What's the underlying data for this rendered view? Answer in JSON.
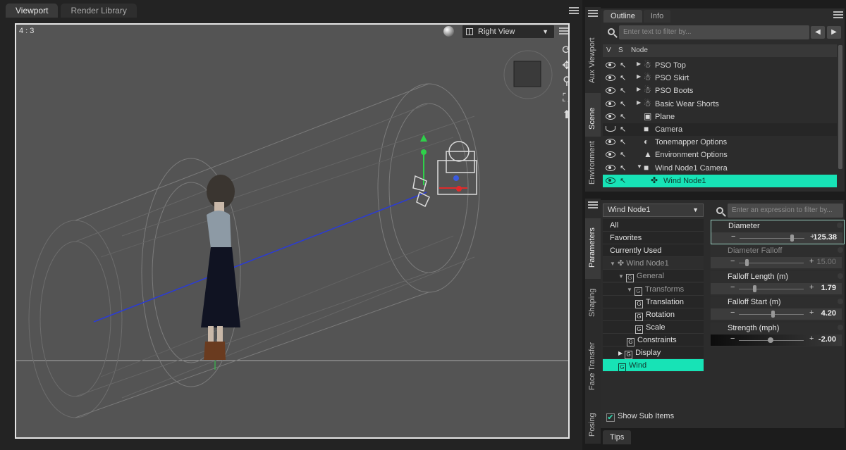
{
  "doc_tabs": [
    {
      "label": "Viewport",
      "active": true
    },
    {
      "label": "Render Library",
      "active": false
    }
  ],
  "viewport": {
    "aspect": "4 : 3",
    "view_name": "Right View"
  },
  "side_tabs": {
    "top": [
      "Aux Viewport",
      "Scene",
      "Environment"
    ],
    "bottom": [
      "Parameters",
      "Shaping",
      "Face Transfer",
      "Posing"
    ]
  },
  "scene": {
    "tabs": [
      "Outline",
      "Info"
    ],
    "filter_placeholder": "Enter text to filter by...",
    "columns": {
      "v": "V",
      "s": "S",
      "node": "Node"
    },
    "nodes": [
      {
        "label": "PSO Top",
        "icon": "figure-icon",
        "expander": "▶",
        "state": "normal"
      },
      {
        "label": "PSO Skirt",
        "icon": "figure-icon",
        "expander": "▶",
        "state": "normal"
      },
      {
        "label": "PSO Boots",
        "icon": "figure-icon",
        "expander": "▶",
        "state": "normal"
      },
      {
        "label": "Basic Wear Shorts",
        "icon": "figure-icon",
        "expander": "▶",
        "state": "normal"
      },
      {
        "label": "Plane",
        "icon": "cube-icon",
        "expander": "",
        "state": "normal"
      },
      {
        "label": "Camera",
        "icon": "camera-icon",
        "expander": "",
        "state": "hidden"
      },
      {
        "label": "Tonemapper Options",
        "icon": "tonemapper-icon",
        "expander": "",
        "state": "normal"
      },
      {
        "label": "Environment Options",
        "icon": "environment-icon",
        "expander": "",
        "state": "normal"
      },
      {
        "label": "Wind Node1 Camera",
        "icon": "camera-icon",
        "expander": "▼",
        "state": "normal"
      },
      {
        "label": "Wind Node1",
        "icon": "wind-node-icon",
        "expander": "",
        "state": "selected"
      }
    ]
  },
  "parameters": {
    "node_select": "Wind Node1",
    "filter_placeholder": "Enter an expression to filter by...",
    "nav": [
      {
        "label": "All",
        "indent": 0,
        "kind": "item"
      },
      {
        "label": "Favorites",
        "indent": 0,
        "kind": "item"
      },
      {
        "label": "Currently Used",
        "indent": 0,
        "kind": "item"
      },
      {
        "label": "Wind Node1",
        "indent": 0,
        "kind": "node"
      },
      {
        "label": "General",
        "indent": 1,
        "kind": "group"
      },
      {
        "label": "Transforms",
        "indent": 2,
        "kind": "group"
      },
      {
        "label": "Translation",
        "indent": 3,
        "kind": "leaf"
      },
      {
        "label": "Rotation",
        "indent": 3,
        "kind": "leaf"
      },
      {
        "label": "Scale",
        "indent": 3,
        "kind": "leaf"
      },
      {
        "label": "Constraints",
        "indent": 2,
        "kind": "leaf"
      },
      {
        "label": "Display",
        "indent": 1,
        "kind": "group"
      },
      {
        "label": "Wind",
        "indent": 1,
        "kind": "selected"
      }
    ],
    "properties": [
      {
        "name": "Diameter",
        "value": "125.38",
        "level": 0.78,
        "enabled": true,
        "selected": true
      },
      {
        "name": "Diameter Falloff",
        "value": "15.00",
        "level": 0.1,
        "enabled": false,
        "selected": false
      },
      {
        "name": "Falloff Length (m)",
        "value": "1.79",
        "level": 0.22,
        "enabled": true,
        "selected": false
      },
      {
        "name": "Falloff Start (m)",
        "value": "4.20",
        "level": 0.5,
        "enabled": true,
        "selected": false
      },
      {
        "name": "Strength (mph)",
        "value": "-2.00",
        "level": 0.45,
        "enabled": true,
        "selected": false
      }
    ],
    "show_sub_items": "Show Sub Items"
  },
  "bottom_tab": "Tips",
  "colors": {
    "accent": "#17e3b6",
    "viewport_bg": "#545454"
  }
}
